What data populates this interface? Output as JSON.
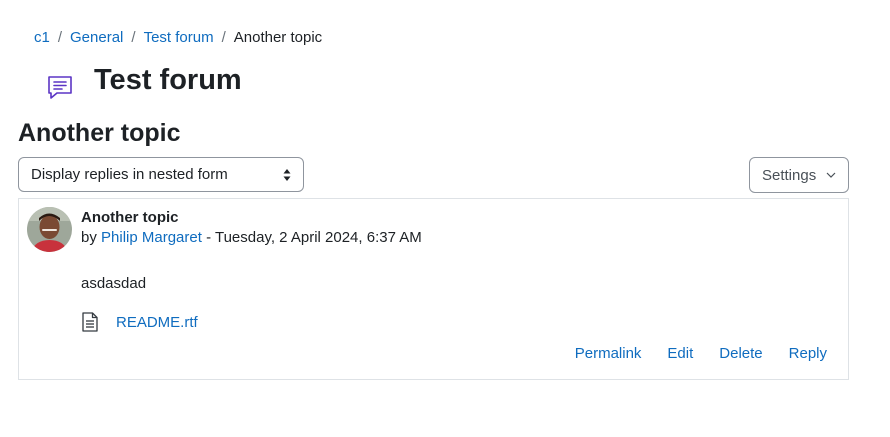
{
  "breadcrumb": {
    "items": [
      "c1",
      "General",
      "Test forum"
    ],
    "current": "Another topic",
    "separator": "/"
  },
  "page": {
    "title": "Test forum",
    "icon": "forum-speech-bubble-icon"
  },
  "discussion": {
    "title": "Another topic",
    "display_mode": "Display replies in nested form",
    "settings_label": "Settings"
  },
  "post": {
    "subject": "Another topic",
    "by_prefix": "by",
    "author": "Philip Margaret",
    "date": "- Tuesday, 2 April 2024, 6:37 AM",
    "body": "asdasdad",
    "attachment": "README.rtf",
    "actions": {
      "permalink": "Permalink",
      "edit": "Edit",
      "delete": "Delete",
      "reply": "Reply"
    }
  },
  "colors": {
    "link": "#0f6cbf",
    "text": "#1d2125",
    "forum_icon": "#5b35c5",
    "border": "#dee2e6"
  }
}
